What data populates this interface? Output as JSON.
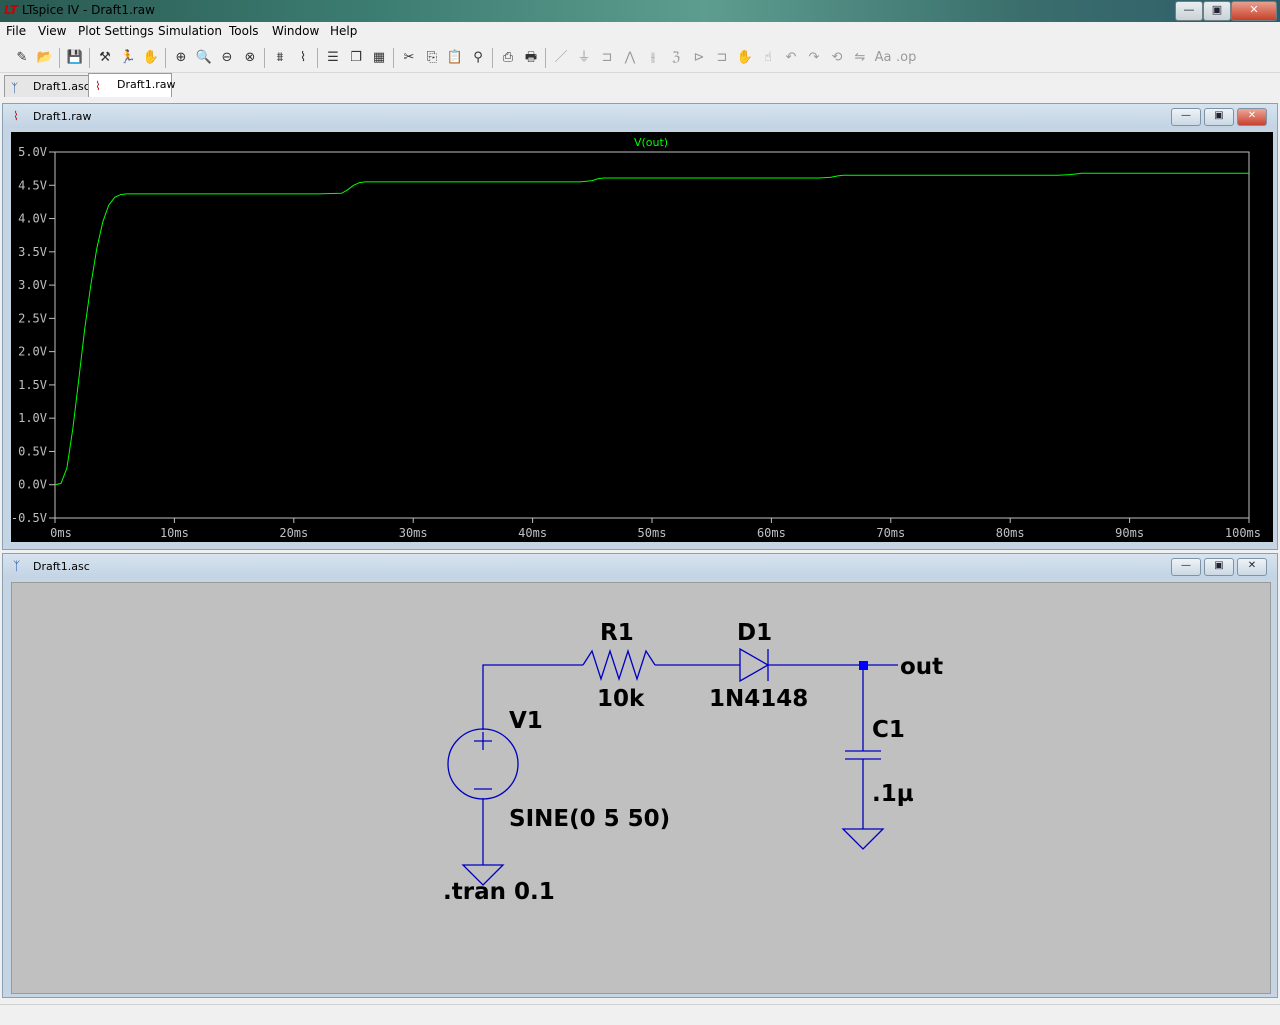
{
  "window": {
    "title": "LTspice IV - Draft1.raw",
    "app_icon": "ltspice-logo-icon",
    "controls": {
      "minimize": "—",
      "maximize": "▣",
      "close": "✕"
    }
  },
  "menu": [
    "File",
    "View",
    "Plot Settings",
    "Simulation",
    "Tools",
    "Window",
    "Help"
  ],
  "toolbar": {
    "groups": [
      [
        "new-schematic-icon",
        "open-icon"
      ],
      [
        "save-icon"
      ],
      [
        "control-panel-icon",
        "run-icon",
        "pan-icon"
      ],
      [
        "zoom-in-icon",
        "zoom-full-icon",
        "zoom-out-icon",
        "zoom-cancel-icon"
      ],
      [
        "autorange-icon",
        "waveform-icon"
      ],
      [
        "tile-horizontal-icon",
        "cascade-icon",
        "tile-windows-icon"
      ],
      [
        "cut-icon",
        "copy-icon",
        "paste-icon",
        "find-icon"
      ],
      [
        "print-preview-icon",
        "print-icon"
      ],
      [
        "wire-icon",
        "ground-icon",
        "label-icon",
        "resistor-icon",
        "capacitor-icon",
        "inductor-icon",
        "diode-icon",
        "component-icon",
        "move-icon",
        "drag-icon",
        "undo-icon",
        "redo-icon",
        "rotate-icon",
        "mirror-icon",
        "text-icon",
        "spice-directive-icon"
      ]
    ]
  },
  "tabs": [
    {
      "label": "Draft1.asc",
      "icon": "schematic-icon",
      "active": false
    },
    {
      "label": "Draft1.raw",
      "icon": "waveform-icon",
      "active": true
    }
  ],
  "plot_window": {
    "title": "Draft1.raw",
    "icon": "waveform-icon"
  },
  "schematic_window": {
    "title": "Draft1.asc",
    "icon": "schematic-icon"
  },
  "colors": {
    "trace": "#00ff00",
    "plot_bg": "#000000",
    "axis_text": "#c0c0c0",
    "wire": "#0000c0",
    "junction": "#0000ff",
    "schematic_bg": "#c0c0c0"
  },
  "chart_data": {
    "type": "line",
    "series": [
      {
        "name": "V(out)",
        "x": [
          0,
          0.5,
          1,
          1.5,
          2,
          2.5,
          3,
          3.5,
          4,
          4.5,
          5,
          5.5,
          6,
          6.5,
          7,
          10,
          15,
          20,
          22,
          24,
          24.5,
          25,
          25.5,
          26,
          30,
          35,
          40,
          44,
          45,
          45.5,
          46,
          50,
          55,
          60,
          64,
          65,
          65.5,
          66,
          70,
          75,
          80,
          84,
          85,
          85.5,
          86,
          90,
          95,
          100
        ],
        "y": [
          0,
          0.02,
          0.25,
          0.85,
          1.6,
          2.35,
          3.0,
          3.55,
          3.95,
          4.2,
          4.32,
          4.36,
          4.37,
          4.37,
          4.37,
          4.37,
          4.37,
          4.37,
          4.37,
          4.38,
          4.43,
          4.5,
          4.54,
          4.55,
          4.55,
          4.55,
          4.55,
          4.55,
          4.57,
          4.6,
          4.61,
          4.61,
          4.61,
          4.61,
          4.61,
          4.62,
          4.64,
          4.65,
          4.65,
          4.65,
          4.65,
          4.65,
          4.66,
          4.67,
          4.68,
          4.68,
          4.68,
          4.68
        ]
      }
    ],
    "xlabel": "",
    "ylabel": "",
    "xlim": [
      0,
      100
    ],
    "ylim": [
      -0.5,
      5.0
    ],
    "xticks": [
      "0ms",
      "10ms",
      "20ms",
      "30ms",
      "40ms",
      "50ms",
      "60ms",
      "70ms",
      "80ms",
      "90ms",
      "100ms"
    ],
    "yticks": [
      "5.0V",
      "4.5V",
      "4.0V",
      "3.5V",
      "3.0V",
      "2.5V",
      "2.0V",
      "1.5V",
      "1.0V",
      "0.5V",
      "0.0V",
      "-0.5V"
    ],
    "grid": false,
    "legend": "top-center"
  },
  "schematic": {
    "labels": {
      "r1_name": "R1",
      "r1_value": "10k",
      "d1_name": "D1",
      "d1_value": "1N4148",
      "v1_name": "V1",
      "v1_value": "SINE(0 5 50)",
      "c1_name": "C1",
      "c1_value": ".1µ",
      "net_out": "out",
      "directive": ".tran 0.1"
    }
  }
}
